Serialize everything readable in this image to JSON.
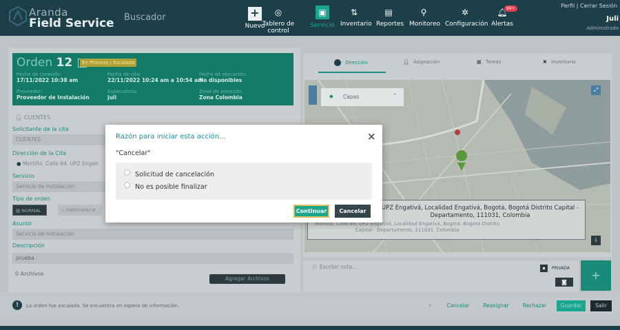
{
  "header": {
    "brand_line1": "Aranda",
    "brand_line2": "Field Service",
    "search_label": "Buscador",
    "nav": [
      {
        "label": "Nuevo",
        "icon": "plus-icon"
      },
      {
        "label": "Tablero de control",
        "icon": "gauge-icon"
      },
      {
        "label": "Servicio",
        "icon": "briefcase-icon"
      },
      {
        "label": "Inventario",
        "icon": "inventory-icon"
      },
      {
        "label": "Reportes",
        "icon": "report-icon"
      },
      {
        "label": "Monitoreo",
        "icon": "monitor-icon"
      },
      {
        "label": "Configuración",
        "icon": "gear-icon"
      },
      {
        "label": "Alertas",
        "icon": "bell-icon",
        "badge": "99+"
      }
    ],
    "user_links": "Perfil  |  Cerrar Sesión",
    "user_name": "Juli",
    "user_role": "Administrado"
  },
  "order": {
    "title_prefix": "Orden",
    "number": "12",
    "letter": "A",
    "status": "En Proceso / Escalada",
    "creation_label": "Fecha de creación:",
    "creation_value": "17/11/2022 10:38 am",
    "appointment_label": "Fecha de cita:",
    "appointment_value": "22/11/2022 10:24 am a 10:54 am",
    "execution_label": "Fecha de ejecución:",
    "execution_value": "No disponibles",
    "provider_label": "Proveedor:",
    "provider_value": "Proveedor de Instalación",
    "specialist_label": "Especialista:",
    "specialist_value": "juli",
    "zone_label": "Zona de atención:",
    "zone_value": "Zona Colombia"
  },
  "form": {
    "clients_section": "CLIENTES",
    "requester_label": "Solicitante de la cita",
    "requester_value": "CLIENTES",
    "address_label": "Dirección de la Cita",
    "address_value": "Mortiño, Calle 64, UPZ Engati",
    "service_label": "Servicio",
    "service_value": "Servicio de Instalación",
    "order_type_label": "Tipo de orden",
    "type_normal": "NORMAL",
    "type_emergency": "EMERGENCIA",
    "subject_label": "Asunto",
    "subject_value": "Servicio de Instalación",
    "description_label": "Descripción",
    "description_value": "prueba",
    "files_label": "0 Archivos",
    "add_files": "Agregar Archivos"
  },
  "tabs": [
    {
      "label": "Dirección",
      "icon": "pin-icon"
    },
    {
      "label": "Asignación",
      "icon": "person-icon"
    },
    {
      "label": "Tareas",
      "icon": "calendar-icon"
    },
    {
      "label": "Inventario",
      "icon": "tools-icon"
    }
  ],
  "map": {
    "layers_label": "Capas",
    "address_full": "UPZ Engativá, Localidad Engativá, Bogotá, Bogotá Distrito Capital - Departamento, 111031, Colombia",
    "address_short": "Mortiño, Calle 64, UPZ Engativá, Localidad Engativá, Bogotá, Bogotá Distrito Capital - Departamento, 111031, Colombia"
  },
  "notes": {
    "placeholder": "Escribir nota...",
    "private_label": "PRIVADA",
    "send_icon": "plus-icon"
  },
  "footer": {
    "info_text": "La orden fue escalada. Se encuentra en espera de información.",
    "buttons": {
      "cancel": "Cancelar",
      "reassign": "Reasignar",
      "reject": "Rechazar",
      "save": "Guardar",
      "exit": "Salir"
    }
  },
  "modal": {
    "title": "Razón para iniciar esta acción...",
    "action": "\"Cancelar\"",
    "options": [
      "Solicitud de cancelación",
      "No es posible finalizar"
    ],
    "continue": "Continuar",
    "cancel": "Cancelar"
  },
  "colors": {
    "primary": "#1aa78e",
    "header": "#1d3f4a",
    "dark_button": "#35454c",
    "modal_title": "#1a8a9a"
  }
}
